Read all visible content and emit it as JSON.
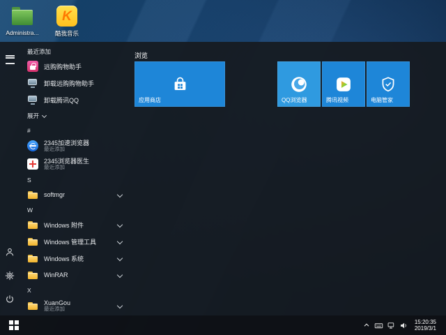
{
  "desktop": {
    "icons": [
      {
        "label": "Administra...",
        "name": "administrator-folder"
      },
      {
        "label": "酷我音乐",
        "name": "kuwo-music",
        "glyph": "K"
      }
    ]
  },
  "start": {
    "recent_header": "最近添加",
    "recent_items": [
      {
        "label": "远购购物助手"
      },
      {
        "label": "卸载远购购物助手"
      },
      {
        "label": "卸载腾讯QQ"
      }
    ],
    "expand_label": "展开",
    "section_hash": "#",
    "section_s": "S",
    "section_w": "W",
    "section_x": "X",
    "apps": {
      "browser2345": {
        "label": "2345加速浏览器",
        "sub": "最近添加"
      },
      "doctor2345": {
        "label": "2345浏览器医生",
        "sub": "最近添加"
      },
      "softmgr": {
        "label": "softmgr"
      },
      "windows_accessories": {
        "label": "Windows 附件"
      },
      "windows_admin_tools": {
        "label": "Windows 管理工具"
      },
      "windows_system": {
        "label": "Windows 系统"
      },
      "winrar": {
        "label": "WinRAR"
      },
      "xuangou": {
        "label": "XuanGou",
        "sub": "最近添加"
      }
    }
  },
  "tiles": {
    "group_label": "浏览",
    "app_store": {
      "label": "应用商店",
      "color": "#1e86d8"
    },
    "qq_browser": {
      "label": "QQ浏览器",
      "color": "#2f9ae0"
    },
    "tencent_video": {
      "label": "腾讯视频",
      "color": "#1e86d8"
    },
    "pc_manager": {
      "label": "电脑管家",
      "color": "#1e86d8"
    }
  },
  "taskbar": {
    "time": "15:20:35",
    "date": "2019/3/1"
  }
}
